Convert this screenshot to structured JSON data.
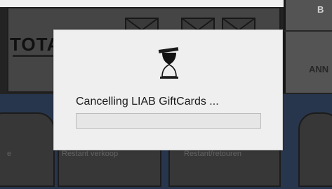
{
  "background": {
    "total_label": "TOTA",
    "right_top_label": "B",
    "right_bottom_label": "ANN",
    "tiles": [
      {
        "label": "e"
      },
      {
        "label": "Restant verkoop"
      },
      {
        "label": "Restant/retouren"
      }
    ]
  },
  "dialog": {
    "message": "Cancelling LIAB GiftCards ...",
    "progress": 0,
    "icon": "hourglass-icon"
  },
  "colors": {
    "dialog_bg": "#efefef",
    "app_dark": "#262626",
    "accent_progress": "#4caf50"
  }
}
